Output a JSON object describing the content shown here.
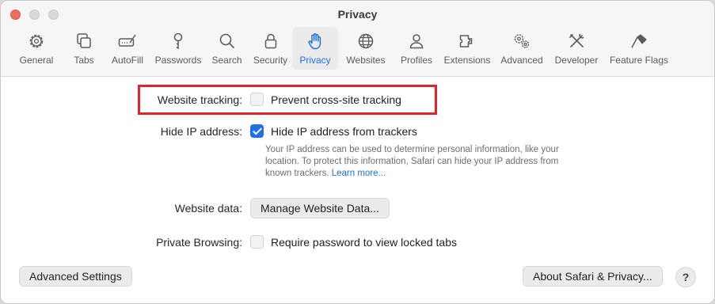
{
  "window": {
    "title": "Privacy"
  },
  "toolbar": {
    "tabs": [
      {
        "label": "General",
        "icon": "gear-icon",
        "active": false
      },
      {
        "label": "Tabs",
        "icon": "tabs-icon",
        "active": false
      },
      {
        "label": "AutoFill",
        "icon": "autofill-icon",
        "active": false
      },
      {
        "label": "Passwords",
        "icon": "key-icon",
        "active": false
      },
      {
        "label": "Search",
        "icon": "search-icon",
        "active": false
      },
      {
        "label": "Security",
        "icon": "lock-icon",
        "active": false
      },
      {
        "label": "Privacy",
        "icon": "hand-icon",
        "active": true
      },
      {
        "label": "Websites",
        "icon": "globe-icon",
        "active": false
      },
      {
        "label": "Profiles",
        "icon": "person-icon",
        "active": false
      },
      {
        "label": "Extensions",
        "icon": "puzzle-icon",
        "active": false
      },
      {
        "label": "Advanced",
        "icon": "gears-icon",
        "active": false
      },
      {
        "label": "Developer",
        "icon": "tools-icon",
        "active": false
      },
      {
        "label": "Feature Flags",
        "icon": "flags-icon",
        "active": false
      }
    ]
  },
  "settings": {
    "website_tracking": {
      "label": "Website tracking:",
      "option": "Prevent cross-site tracking",
      "checked": false
    },
    "hide_ip": {
      "label": "Hide IP address:",
      "option": "Hide IP address from trackers",
      "checked": true,
      "description": "Your IP address can be used to determine personal information, like your location. To protect this information, Safari can hide your IP address from known trackers.",
      "link": "Learn more..."
    },
    "website_data": {
      "label": "Website data:",
      "button": "Manage Website Data..."
    },
    "private_browsing": {
      "label": "Private Browsing:",
      "option": "Require password to view locked tabs",
      "checked": false
    }
  },
  "footer": {
    "advanced_button": "Advanced Settings",
    "about_button": "About Safari & Privacy...",
    "help": "?"
  },
  "colors": {
    "accent": "#1f6fe5",
    "highlight": "#e3232b"
  }
}
